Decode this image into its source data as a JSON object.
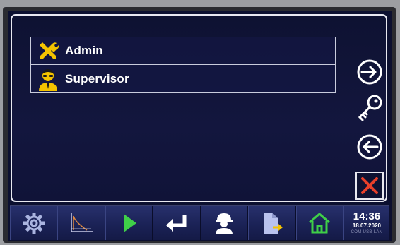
{
  "users": [
    {
      "label": "Admin",
      "icon": "wrench-screwdriver-icon"
    },
    {
      "label": "Supervisor",
      "icon": "supervisor-person-icon"
    }
  ],
  "side_actions": [
    {
      "name": "login-icon"
    },
    {
      "name": "key-icon"
    },
    {
      "name": "logout-icon"
    },
    {
      "name": "close-icon"
    }
  ],
  "toolbar": [
    {
      "name": "gear-icon"
    },
    {
      "name": "chart-icon"
    },
    {
      "name": "play-icon"
    },
    {
      "name": "enter-icon"
    },
    {
      "name": "worker-icon"
    },
    {
      "name": "export-document-icon"
    },
    {
      "name": "home-icon"
    }
  ],
  "clock": {
    "time": "14:36",
    "date": "18.07.2020",
    "ports": "COM  USB  LAN"
  },
  "colors": {
    "accent_yellow": "#f4c300",
    "play_green": "#3fcf48",
    "close_red": "#e8402a",
    "panel_bg": "#0e1232"
  }
}
